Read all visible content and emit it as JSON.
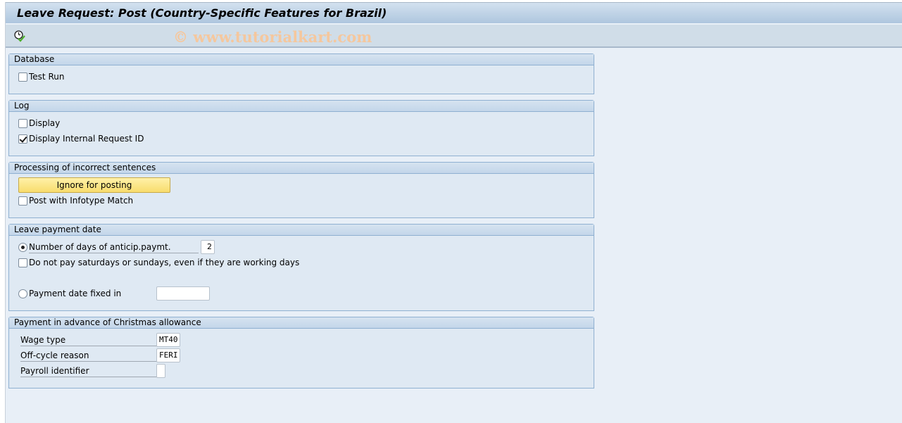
{
  "window": {
    "title": "Leave Request: Post (Country-Specific Features for Brazil)"
  },
  "toolbar": {
    "execute_icon": "clock-checkmark-icon",
    "watermark": "© www.tutorialkart.com"
  },
  "sections": {
    "database": {
      "title": "Database",
      "test_run": {
        "label": "Test Run",
        "checked": false
      }
    },
    "log": {
      "title": "Log",
      "display": {
        "label": "Display",
        "checked": false
      },
      "display_internal_id": {
        "label": "Display Internal Request ID",
        "checked": true
      }
    },
    "processing": {
      "title": "Processing of incorrect sentences",
      "ignore_button": "Ignore for posting",
      "post_infotype_match": {
        "label": "Post with Infotype Match",
        "checked": false
      }
    },
    "leave_payment_date": {
      "title": "Leave payment date",
      "days_anticip": {
        "label": "Number of days of anticip.paymt.",
        "selected": true,
        "value": "2"
      },
      "no_weekend": {
        "label": "Do not pay saturdays or sundays, even if they are working days",
        "checked": false
      },
      "payment_date_fixed": {
        "label": "Payment date fixed in",
        "selected": false,
        "value": ""
      }
    },
    "christmas": {
      "title": "Payment in advance of Christmas allowance",
      "wage_type": {
        "label": "Wage type",
        "value": "MT40"
      },
      "offcycle_reason": {
        "label": "Off-cycle reason",
        "value": "FERI"
      },
      "payroll_identifier": {
        "label": "Payroll identifier",
        "value": ""
      }
    }
  }
}
